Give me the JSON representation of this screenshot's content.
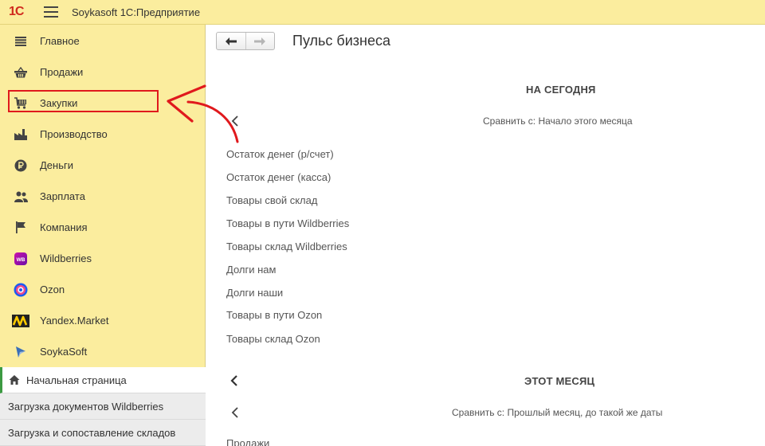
{
  "app": {
    "logo": "1С",
    "title": "Soykasoft 1С:Предприятие"
  },
  "sidebar": {
    "items": [
      {
        "label": "Главное",
        "icon": "list-icon"
      },
      {
        "label": "Продажи",
        "icon": "basket-icon"
      },
      {
        "label": "Закупки",
        "icon": "cart-icon"
      },
      {
        "label": "Производство",
        "icon": "factory-icon"
      },
      {
        "label": "Деньги",
        "icon": "ruble-coin-icon"
      },
      {
        "label": "Зарплата",
        "icon": "people-icon"
      },
      {
        "label": "Компания",
        "icon": "flag-icon"
      },
      {
        "label": "Wildberries",
        "icon": "wildberries-logo-icon",
        "badge": "WB"
      },
      {
        "label": "Ozon",
        "icon": "ozon-logo-icon"
      },
      {
        "label": "Yandex.Market",
        "icon": "yandex-market-logo-icon"
      },
      {
        "label": "SoykaSoft",
        "icon": "soykasoft-logo-icon"
      }
    ]
  },
  "windows": {
    "items": [
      {
        "label": "Начальная страница",
        "active": true
      },
      {
        "label": "Загрузка документов Wildberries",
        "active": false
      },
      {
        "label": "Загрузка и сопоставление складов",
        "active": false
      }
    ]
  },
  "main": {
    "title": "Пульс бизнеса",
    "today": {
      "heading": "НА СЕГОДНЯ",
      "compare": "Сравнить с: Начало этого месяца",
      "indicators": [
        "Остаток денег (р/счет)",
        "Остаток денег (касса)",
        "Товары свой склад",
        "Товары в пути Wildberries",
        "Товары склад Wildberries",
        "Долги нам",
        "Долги наши",
        "Товары в пути Ozon",
        "Товары склад Ozon"
      ]
    },
    "month": {
      "heading": "ЭТОТ МЕСЯЦ",
      "compare": "Сравнить с: Прошлый месяц, до такой же даты",
      "indicators": [
        "Продажи"
      ]
    }
  },
  "colors": {
    "sidebar_bg": "#fbed9e",
    "highlight": "#e0191d",
    "active_window": "#3c9a42"
  }
}
